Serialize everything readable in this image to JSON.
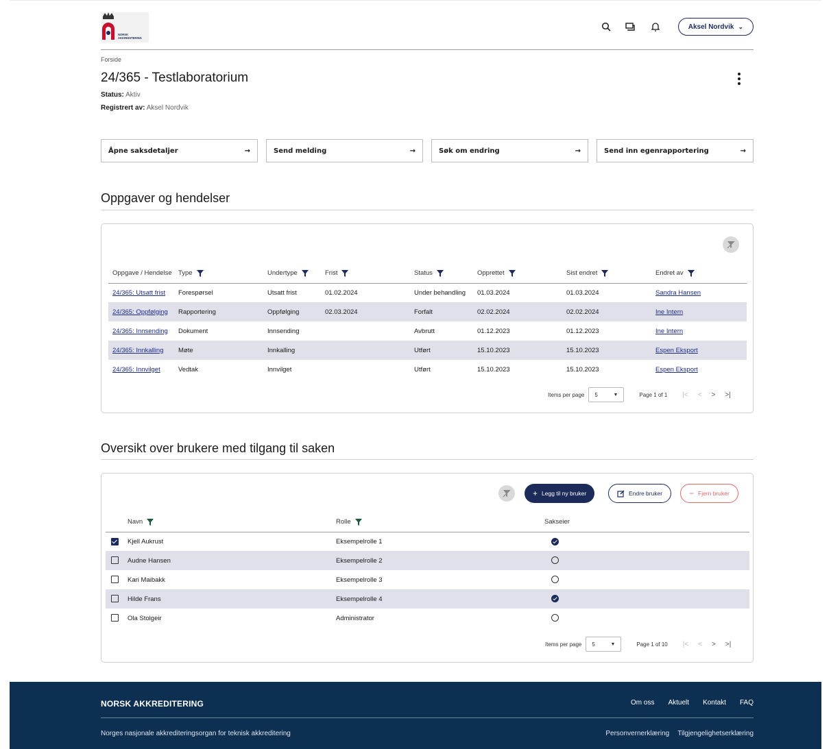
{
  "header": {
    "logo_text": "NORSK AKKREDITERING",
    "user_label": "Aksel Nordvik"
  },
  "breadcrumb": "Forside",
  "title": "24/365 - Testlaboratorium",
  "status": {
    "label": "Status:",
    "value": "Aktiv"
  },
  "registered": {
    "label": "Registrert av:",
    "value": "Aksel Nordvik"
  },
  "actions": [
    {
      "label": "Åpne saksdetaljer"
    },
    {
      "label": "Send melding"
    },
    {
      "label": "Søk om endring"
    },
    {
      "label": "Send inn egenrapportering"
    }
  ],
  "tasks": {
    "title": "Oppgaver og hendelser",
    "columns": [
      "Oppgave / Hendelse",
      "Type",
      "Undertype",
      "Frist",
      "Status",
      "Opprettet",
      "Sist endret",
      "Endret av"
    ],
    "rows": [
      {
        "task": "24/365: Utsatt frist",
        "type": "Forespørsel",
        "subtype": "Utsatt frist",
        "deadline": "01.02.2024",
        "status": "Under behandling",
        "created": "01.03.2024",
        "changed": "01.03.2024",
        "by": "Sandra Hansen"
      },
      {
        "task": "24/365: Oppfølging",
        "type": "Rapportering",
        "subtype": "Oppfølging",
        "deadline": "02.03.2024",
        "status": "Forfalt",
        "created": "02.02.2024",
        "changed": "02.02.2024",
        "by": "Ine Intern"
      },
      {
        "task": "24/365: Innsending",
        "type": "Dokument",
        "subtype": "Innsending",
        "deadline": "",
        "status": "Avbrutt",
        "created": "01.12.2023",
        "changed": "01.12.2023",
        "by": "Ine Intern"
      },
      {
        "task": "24/365: Innkalling",
        "type": "Møte",
        "subtype": "Innkalling",
        "deadline": "",
        "status": "Utført",
        "created": "15.10.2023",
        "changed": "15.10.2023",
        "by": "Espen Eksport"
      },
      {
        "task": "24/365: Innvilget",
        "type": "Vedtak",
        "subtype": "Innvilget",
        "deadline": "",
        "status": "Utført",
        "created": "15.10.2023",
        "changed": "15.10.2023",
        "by": "Espen Eksport"
      }
    ],
    "pager": {
      "items_label": "Items per page",
      "per_page": "5",
      "page_text": "Page 1 of 1"
    }
  },
  "users": {
    "title": "Oversikt over brukere med tilgang til saken",
    "add_label": "Legg til ny bruker",
    "edit_label": "Endre bruker",
    "remove_label": "Fjern bruker",
    "columns": [
      "Navn",
      "Rolle",
      "Sakseier"
    ],
    "rows": [
      {
        "name": "Kjell Aukrust",
        "role": "Eksempelrolle 1",
        "checked": true,
        "owner": true
      },
      {
        "name": "Audne Hansen",
        "role": "Eksempelrolle 2",
        "checked": false,
        "owner": false
      },
      {
        "name": "Kari Maibakk",
        "role": "Eksempelrolle 3",
        "checked": false,
        "owner": false
      },
      {
        "name": "Hilde Frans",
        "role": "Eksempelrolle 4",
        "checked": false,
        "owner": true
      },
      {
        "name": "Ola Stolgeir",
        "role": "Administrator",
        "checked": false,
        "owner": false
      }
    ],
    "pager": {
      "items_label": "Items per page",
      "per_page": "5",
      "page_text": "Page 1 of 10"
    }
  },
  "footer": {
    "brand": "NORSK AKKREDITERING",
    "links": [
      "Om oss",
      "Aktuelt",
      "Kontakt",
      "FAQ"
    ],
    "subtitle": "Norges nasjonale akkrediteringsorgan for teknisk akkreditering",
    "legal": [
      "Personvernerklæring",
      "Tilgjengelighetserklæring"
    ]
  },
  "colors": {
    "brand_navy": "#1c2b5a",
    "footer_bg": "#0c2f52",
    "row_alt": "#dfe0ea",
    "link": "#1c2b8a",
    "danger": "#e06a6a",
    "logo_red": "#c8102e"
  },
  "icons": {
    "search": "search-icon",
    "messages": "chat-icon",
    "notifications": "bell-icon",
    "filter": "filter-icon",
    "clear_filter": "filter-clear-icon"
  }
}
